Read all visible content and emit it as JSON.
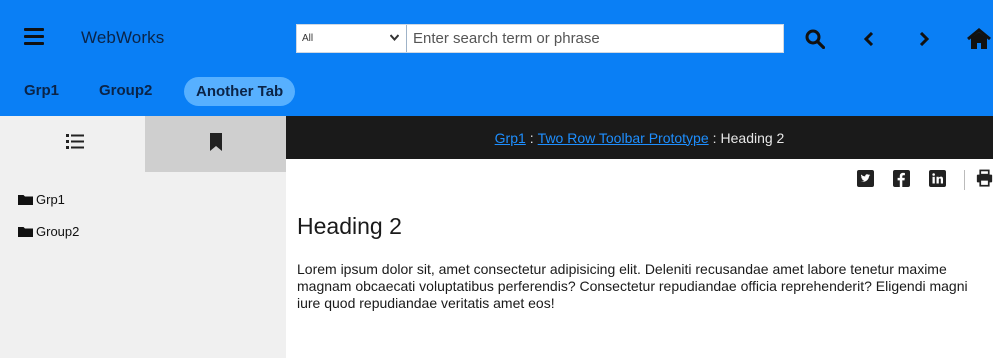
{
  "header": {
    "brand": "WebWorks",
    "search": {
      "scope_value": "All",
      "scope_options": [
        "All"
      ],
      "placeholder": "Enter search term or phrase",
      "value": ""
    },
    "icons": [
      "menu-icon",
      "search-icon",
      "chevron-left-icon",
      "chevron-right-icon",
      "home-icon"
    ]
  },
  "tabs": [
    {
      "label": "Grp1"
    },
    {
      "label": "Group2"
    },
    {
      "label": "Another Tab",
      "active": true
    }
  ],
  "sidebar": {
    "tabs": [
      "list-icon",
      "bookmark-icon"
    ],
    "items": [
      {
        "label": "Grp1",
        "icon": "folder-icon"
      },
      {
        "label": "Group2",
        "icon": "folder-icon"
      }
    ]
  },
  "breadcrumb": {
    "items": [
      {
        "label": "Grp1",
        "link": true
      },
      {
        "label": "Two Row Toolbar Prototype",
        "link": true
      },
      {
        "label": "Heading 2",
        "link": false
      }
    ],
    "separator": ":"
  },
  "share": {
    "icons": [
      "twitter-icon",
      "facebook-icon",
      "linkedin-icon",
      "print-icon"
    ]
  },
  "content": {
    "heading": "Heading 2",
    "paragraph": "Lorem ipsum dolor sit, amet consectetur adipisicing elit. Deleniti recusandae amet labore tenetur maxime magnam obcaecati voluptatibus perferendis? Consectetur repudiandae officia reprehenderit? Eligendi magni iure quod repudiandae veritatis amet eos!"
  },
  "colors": {
    "toolbar": "#0a7ff5",
    "active_tab": "#57b0ff",
    "breadcrumb_bar": "#1a1a1a",
    "link": "#1e8fff",
    "sidebar": "#f0f0f0",
    "sidebar_tab_inactive": "#cfcfcf"
  }
}
